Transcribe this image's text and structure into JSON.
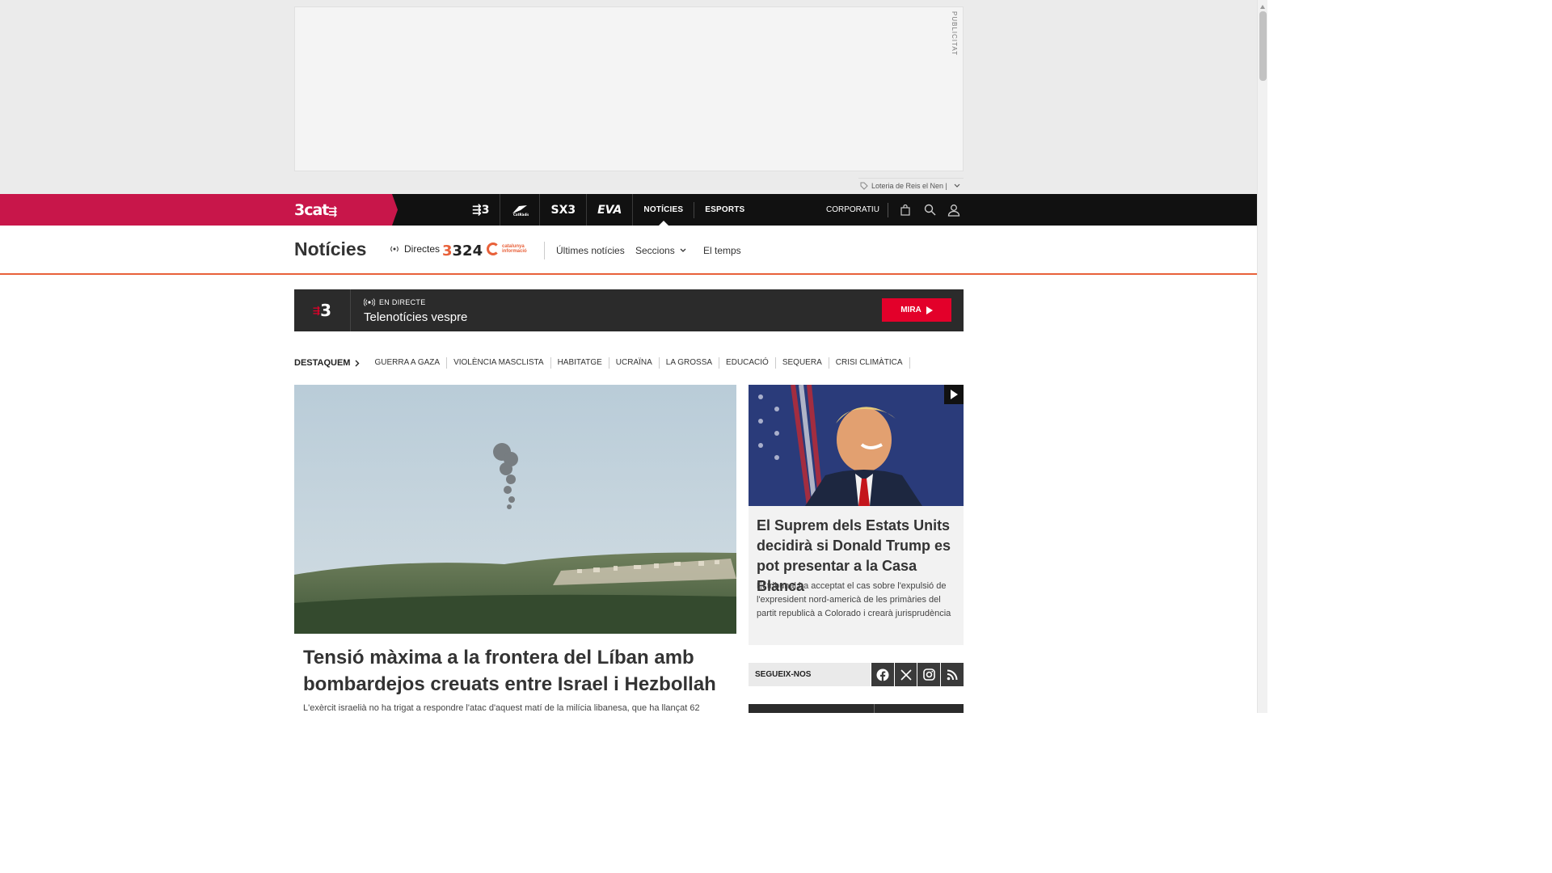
{
  "ad": {
    "label": "PUBLICITAT",
    "sponsor": "Loteria de Reis el Nen |"
  },
  "topnav": {
    "brand": "3cat",
    "channels": [
      {
        "name": "3",
        "icon": "tv3-logo-icon"
      },
      {
        "name": "Cat Ràdio",
        "icon": "catradio-logo-icon"
      },
      {
        "name": "SX3",
        "icon": "sx3-logo-icon"
      },
      {
        "name": "EVA",
        "icon": "eva-logo-icon"
      }
    ],
    "links": [
      "NOTÍCIES",
      "ESPORTS"
    ],
    "active_link": "NOTÍCIES",
    "corporate": "CORPORATIU"
  },
  "section": {
    "title": "Notícies",
    "directes": "Directes",
    "logo_324": "324",
    "logo_ci_line1": "catalunya",
    "logo_ci_line2": "informació",
    "links": [
      "Últimes notícies",
      "Seccions",
      "El temps"
    ]
  },
  "live": {
    "channel": "3",
    "status": "EN DIRECTE",
    "title": "Telenotícies vespre",
    "button": "MIRA"
  },
  "topics": {
    "lead": "DESTAQUEM",
    "items": [
      "GUERRA A GAZA",
      "VIOLÈNCIA MASCLISTA",
      "HABITATGE",
      "UCRAÏNA",
      "LA GROSSA",
      "EDUCACIÓ",
      "SEQUERA",
      "CRISI CLIMÀTICA"
    ]
  },
  "main_article": {
    "title": "Tensió màxima a la frontera del Líban amb bombardejos creuats entre Israel i Hezbollah",
    "lead": "L'exèrcit israelià no ha trigat a respondre l'atac d'aquest matí de la milícia libanesa, que ha llançat 62"
  },
  "side_article": {
    "title": "El Suprem dels Estats Units decidirà si Donald Trump es pot presentar a la Casa Blanca",
    "lead": "El tribunal ha acceptat el cas sobre l'expulsió de l'expresident nord-americà de les primàries del partit republicà a Colorado i crearà jurisprudència"
  },
  "follow": {
    "label": "SEGUEIX-NOS",
    "networks": [
      "facebook-icon",
      "x-icon",
      "instagram-icon",
      "rss-icon"
    ]
  },
  "colors": {
    "brand": "#c8164a",
    "live_button": "#e3002a",
    "section_accent": "#e8613a"
  }
}
